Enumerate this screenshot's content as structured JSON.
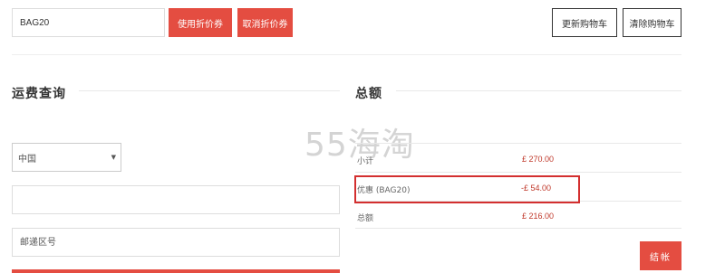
{
  "coupon": {
    "value": "BAG20",
    "apply_label": "使用折价券",
    "remove_label": "取消折价券"
  },
  "cart_actions": {
    "update_label": "更新购物车",
    "clear_label": "清除购物车"
  },
  "shipping": {
    "title": "运费查询",
    "country_selected": "中国",
    "state_field_value": "",
    "postcode_placeholder": "邮递区号"
  },
  "totals": {
    "title": "总额",
    "rows": [
      {
        "label": "小计",
        "value": "£ 270.00"
      },
      {
        "label": "优惠 (BAG20)",
        "value": "-£ 54.00"
      },
      {
        "label": "总额",
        "value": "£ 216.00"
      }
    ],
    "checkout_label": "结帐"
  },
  "watermark": {
    "text": "55海淘"
  },
  "colors": {
    "accent": "#e44d41",
    "highlight": "#d32f2f",
    "price": "#c0392b"
  }
}
